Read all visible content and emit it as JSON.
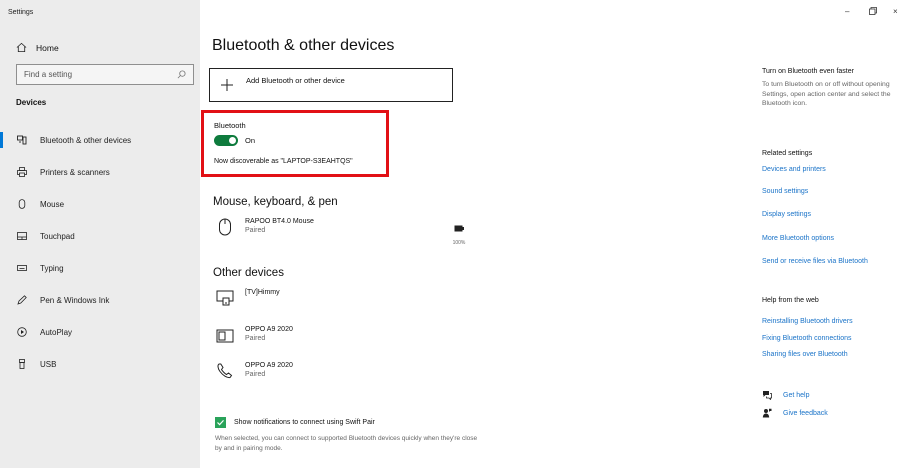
{
  "window": {
    "title": "Settings",
    "controls": {
      "minimize": "–",
      "restore": "ꟷ",
      "close": "×"
    }
  },
  "sidebar": {
    "home_label": "Home",
    "search_placeholder": "Find a setting",
    "section_heading": "Devices",
    "items": [
      {
        "label": "Bluetooth & other devices",
        "icon": "bluetooth-devices-icon",
        "active": true
      },
      {
        "label": "Printers & scanners",
        "icon": "printer-icon",
        "active": false
      },
      {
        "label": "Mouse",
        "icon": "mouse-icon",
        "active": false
      },
      {
        "label": "Touchpad",
        "icon": "touchpad-icon",
        "active": false
      },
      {
        "label": "Typing",
        "icon": "keyboard-icon",
        "active": false
      },
      {
        "label": "Pen & Windows Ink",
        "icon": "pen-icon",
        "active": false
      },
      {
        "label": "AutoPlay",
        "icon": "autoplay-icon",
        "active": false
      },
      {
        "label": "USB",
        "icon": "usb-icon",
        "active": false
      }
    ]
  },
  "main": {
    "title": "Bluetooth & other devices",
    "add_device_label": "Add Bluetooth or other device",
    "bluetooth": {
      "label": "Bluetooth",
      "toggle_state": "On",
      "discoverable_text": "Now discoverable as \"LAPTOP-S3EAHTQS\""
    },
    "mouse_section": {
      "heading": "Mouse, keyboard, & pen",
      "devices": [
        {
          "name": "RAPOO BT4.0 Mouse",
          "status": "Paired",
          "battery": "100%"
        }
      ]
    },
    "other_section": {
      "heading": "Other devices",
      "devices": [
        {
          "name": "[TV]Himmy",
          "status": ""
        },
        {
          "name": "OPPO A9 2020",
          "status": "Paired"
        },
        {
          "name": "OPPO A9 2020",
          "status": "Paired"
        }
      ]
    },
    "swift_pair": {
      "checked": true,
      "label": "Show notifications to connect using Swift Pair",
      "description": "When selected, you can connect to supported Bluetooth devices quickly when they're close by and in pairing mode."
    }
  },
  "right_panel": {
    "tip_heading": "Turn on Bluetooth even faster",
    "tip_text": "To turn Bluetooth on or off without opening Settings, open action center and select the Bluetooth icon.",
    "related_heading": "Related settings",
    "related_links": [
      "Devices and printers",
      "Sound settings",
      "Display settings",
      "More Bluetooth options",
      "Send or receive files via Bluetooth"
    ],
    "help_heading": "Help from the web",
    "help_links": [
      "Reinstalling Bluetooth drivers",
      "Fixing Bluetooth connections",
      "Sharing files over Bluetooth"
    ],
    "get_help": "Get help",
    "give_feedback": "Give feedback"
  },
  "colors": {
    "accent": "#0078d7",
    "toggle_on": "#0e7b3d",
    "highlight_box": "#e21015",
    "link": "#1a73c8",
    "checkbox": "#2aa35a"
  }
}
